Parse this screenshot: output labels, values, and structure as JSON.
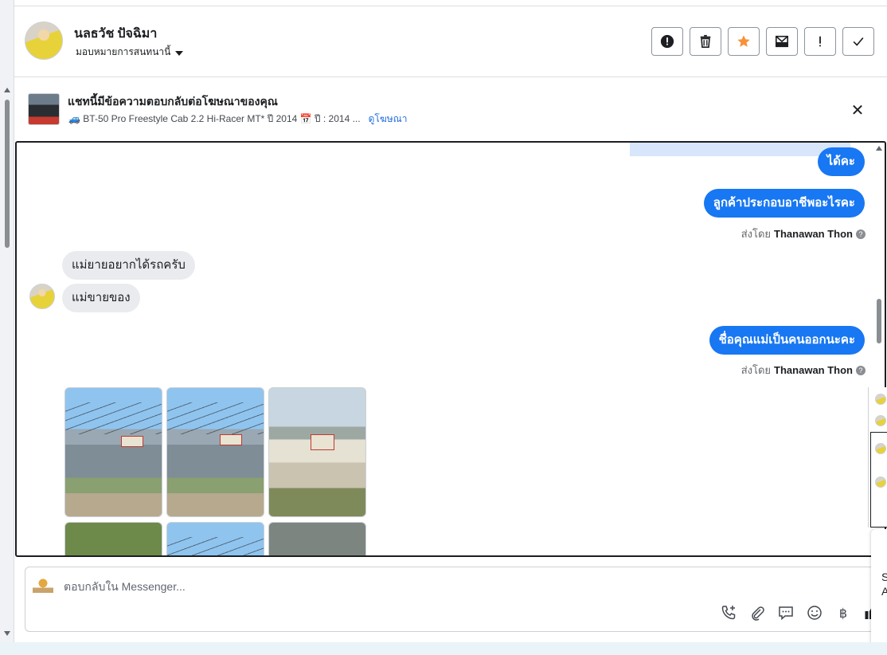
{
  "contact": {
    "name": "นลธวัช ปัจฉิมา",
    "assign_label": "มอบหมายการสนทนานี้"
  },
  "actions": [
    {
      "name": "spam-button",
      "icon": "alert-circle-icon"
    },
    {
      "name": "delete-button",
      "icon": "trash-icon"
    },
    {
      "name": "star-button",
      "icon": "star-icon"
    },
    {
      "name": "mark-unread-button",
      "icon": "envelope-icon"
    },
    {
      "name": "follow-up-button",
      "icon": "exclamation-icon"
    },
    {
      "name": "done-button",
      "icon": "check-icon"
    }
  ],
  "colors": {
    "accent": "#1877f2",
    "star": "#f7923a",
    "link": "#216fdb"
  },
  "ad": {
    "title": "แชทนี้มีข้อความตอบกลับต่อโฆษณาของคุณ",
    "subtitle": "🚙 BT-50 Pro Freestyle Cab 2.2 Hi-Racer MT* ปี 2014 📅 ปี : 2014 ...",
    "link": "ดูโฆษณา"
  },
  "messages": {
    "m1": "ได้คะ",
    "m2": "ลูกค้าประกอบอาชีพอะไรคะ",
    "sent_by_1": {
      "prefix": "ส่งโดย",
      "name": "Thanawan Thon"
    },
    "m3": "แม่ยายอยากได้รถครับ",
    "m4": "แม่ขายของ",
    "m5": "ชื่อคุณแม่เป็นคนออกนะคะ",
    "sent_by_2": {
      "prefix": "ส่งโดย",
      "name": "Thanawan Thon"
    }
  },
  "photos": [
    "shop",
    "shop",
    "truck",
    "tree",
    "shop",
    "dark"
  ],
  "composer": {
    "placeholder": "ตอบกลับใน Messenger...",
    "tools": [
      "phone-add-icon",
      "paperclip-icon",
      "saved-reply-icon",
      "emoji-icon",
      "baht-icon",
      "thumbs-up-icon"
    ],
    "baht_symbol": "฿"
  },
  "side_card": {
    "line1": "S",
    "line2": "A"
  }
}
